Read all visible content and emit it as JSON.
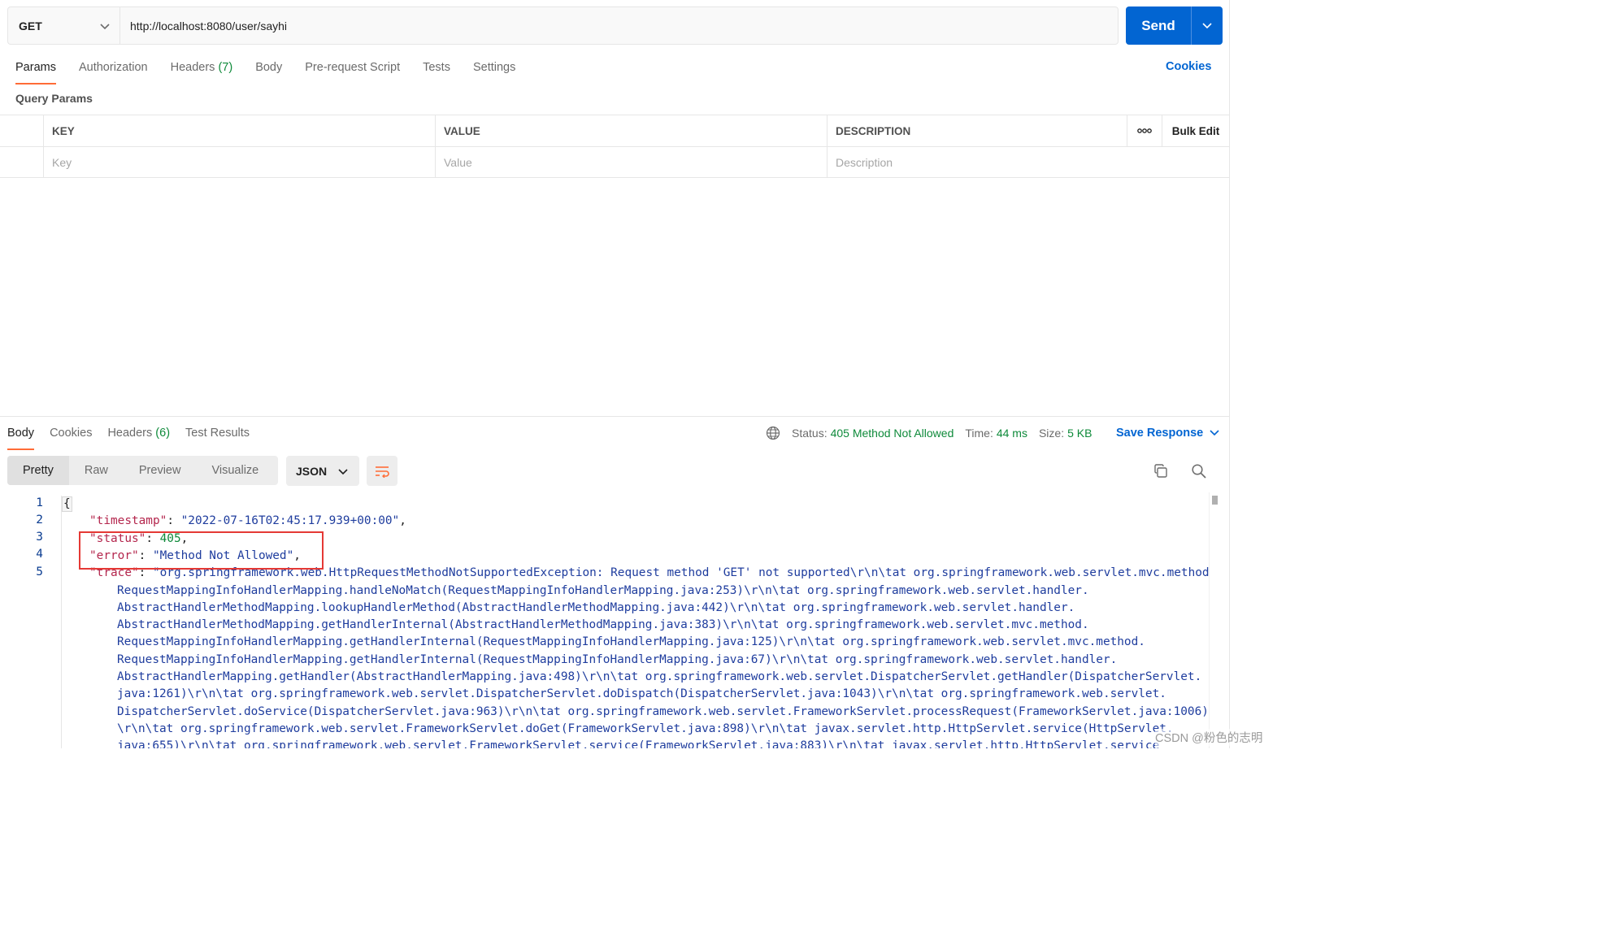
{
  "request": {
    "method": "GET",
    "url": "http://localhost:8080/user/sayhi",
    "send_label": "Send"
  },
  "request_tabs": [
    {
      "label": "Params",
      "active": true
    },
    {
      "label": "Authorization"
    },
    {
      "label": "Headers",
      "count": "(7)"
    },
    {
      "label": "Body"
    },
    {
      "label": "Pre-request Script"
    },
    {
      "label": "Tests"
    },
    {
      "label": "Settings"
    }
  ],
  "cookies_link": "Cookies",
  "params": {
    "title": "Query Params",
    "headers": {
      "key": "KEY",
      "value": "VALUE",
      "description": "DESCRIPTION",
      "bulk_edit": "Bulk Edit"
    },
    "placeholders": {
      "key": "Key",
      "value": "Value",
      "description": "Description"
    }
  },
  "response_tabs": [
    {
      "label": "Body",
      "active": true
    },
    {
      "label": "Cookies"
    },
    {
      "label": "Headers",
      "count": "(6)"
    },
    {
      "label": "Test Results"
    }
  ],
  "status": {
    "status_label": "Status:",
    "status_value": "405 Method Not Allowed",
    "time_label": "Time:",
    "time_value": "44 ms",
    "size_label": "Size:",
    "size_value": "5 KB",
    "save_response": "Save Response"
  },
  "view_modes": [
    "Pretty",
    "Raw",
    "Preview",
    "Visualize"
  ],
  "format": "JSON",
  "code_lines": {
    "line_numbers": [
      "1",
      "2",
      "3",
      "4",
      "5"
    ],
    "open_brace": "{",
    "timestamp_key": "\"timestamp\"",
    "timestamp_value": "\"2022-07-16T02:45:17.939+00:00\"",
    "status_key": "\"status\"",
    "status_value": "405",
    "error_key": "\"error\"",
    "error_value": "\"Method Not Allowed\"",
    "trace_key": "\"trace\"",
    "trace_lines": [
      "\"org.springframework.web.HttpRequestMethodNotSupportedException: Request method 'GET' not supported\\r\\n\\tat org.springframework.web.servlet.mvc.method.",
      "RequestMappingInfoHandlerMapping.handleNoMatch(RequestMappingInfoHandlerMapping.java:253)\\r\\n\\tat org.springframework.web.servlet.handler.",
      "AbstractHandlerMethodMapping.lookupHandlerMethod(AbstractHandlerMethodMapping.java:442)\\r\\n\\tat org.springframework.web.servlet.handler.",
      "AbstractHandlerMethodMapping.getHandlerInternal(AbstractHandlerMethodMapping.java:383)\\r\\n\\tat org.springframework.web.servlet.mvc.method.",
      "RequestMappingInfoHandlerMapping.getHandlerInternal(RequestMappingInfoHandlerMapping.java:125)\\r\\n\\tat org.springframework.web.servlet.mvc.method.",
      "RequestMappingInfoHandlerMapping.getHandlerInternal(RequestMappingInfoHandlerMapping.java:67)\\r\\n\\tat org.springframework.web.servlet.handler.",
      "AbstractHandlerMapping.getHandler(AbstractHandlerMapping.java:498)\\r\\n\\tat org.springframework.web.servlet.DispatcherServlet.getHandler(DispatcherServlet.",
      "java:1261)\\r\\n\\tat org.springframework.web.servlet.DispatcherServlet.doDispatch(DispatcherServlet.java:1043)\\r\\n\\tat org.springframework.web.servlet.",
      "DispatcherServlet.doService(DispatcherServlet.java:963)\\r\\n\\tat org.springframework.web.servlet.FrameworkServlet.processRequest(FrameworkServlet.java:1006)",
      "\\r\\n\\tat org.springframework.web.servlet.FrameworkServlet.doGet(FrameworkServlet.java:898)\\r\\n\\tat javax.servlet.http.HttpServlet.service(HttpServlet.",
      "java:655)\\r\\n\\tat org.springframework.web.servlet.FrameworkServlet.service(FrameworkServlet.java:883)\\r\\n\\tat javax.servlet.http.HttpServlet.service"
    ]
  },
  "watermark": "CSDN @粉色的志明",
  "colors": {
    "accent_tab": "#ff6c37",
    "send_button": "#0265d2",
    "link": "#0265d2",
    "status_ok": "#0e8a3a",
    "json_key": "#b4264d",
    "json_string": "#1f3d9e",
    "json_number": "#0e8a3a",
    "annotation_box": "#e53935"
  },
  "icons": {
    "method_dropdown": "chevron-down-icon",
    "send_dropdown": "chevron-down-icon",
    "more": "more-dots-icon",
    "globe": "globe-icon",
    "wrap": "wrap-lines-icon",
    "copy": "copy-icon",
    "search": "search-icon"
  }
}
